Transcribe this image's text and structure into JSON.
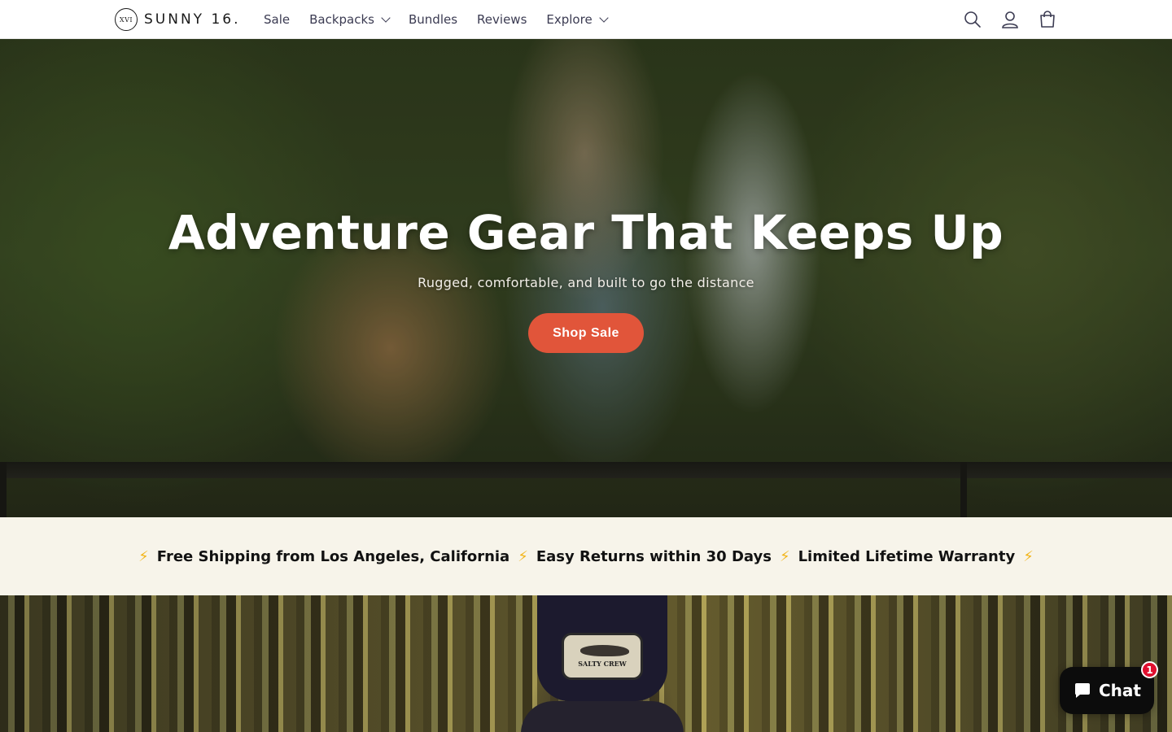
{
  "header": {
    "logo_mark": "XVI",
    "logo_text": "SUNNY 16.",
    "nav": [
      {
        "label": "Sale",
        "has_dropdown": false
      },
      {
        "label": "Backpacks",
        "has_dropdown": true
      },
      {
        "label": "Bundles",
        "has_dropdown": false
      },
      {
        "label": "Reviews",
        "has_dropdown": false
      },
      {
        "label": "Explore",
        "has_dropdown": true
      }
    ],
    "icons": [
      "search-icon",
      "account-icon",
      "cart-icon"
    ]
  },
  "hero": {
    "title": "Adventure Gear That Keeps Up",
    "subtitle": "Rugged, comfortable, and built to go the distance",
    "cta_label": "Shop Sale"
  },
  "benefits": {
    "bolt": "⚡",
    "items": [
      "Free Shipping from Los Angeles, California",
      "Easy Returns within 30 Days",
      "Limited Lifetime Warranty"
    ]
  },
  "section2": {
    "patch_text": "SALTY CREW"
  },
  "chat": {
    "label": "Chat",
    "badge_count": "1"
  },
  "colors": {
    "accent": "#e1553a",
    "nav_text": "#3b3b52",
    "benefits_bg": "#f7f4ea",
    "bolt": "#f2b51b",
    "badge": "#e0102f"
  }
}
